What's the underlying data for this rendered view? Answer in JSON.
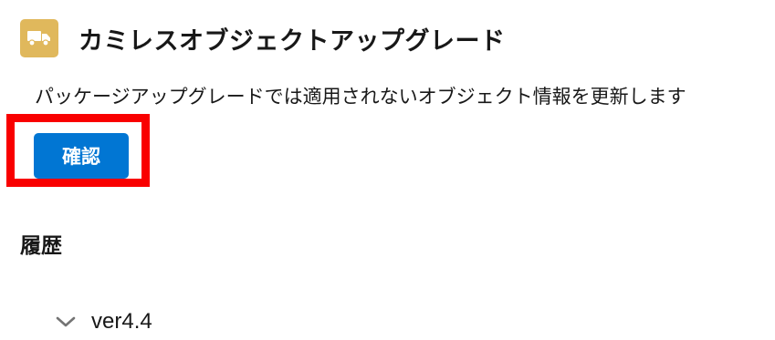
{
  "header": {
    "title": "カミレスオブジェクトアップグレード",
    "icon": "truck-icon",
    "icon_bg_color": "#E0B85C"
  },
  "description": "パッケージアップグレードでは適用されないオブジェクト情報を更新します",
  "confirm_button": {
    "label": "確認",
    "color": "#0176D3",
    "highlight_color": "#F90000"
  },
  "history": {
    "title": "履歴",
    "items": [
      {
        "label": "ver4.4",
        "icon": "chevron-down-icon",
        "expanded": false
      }
    ]
  }
}
